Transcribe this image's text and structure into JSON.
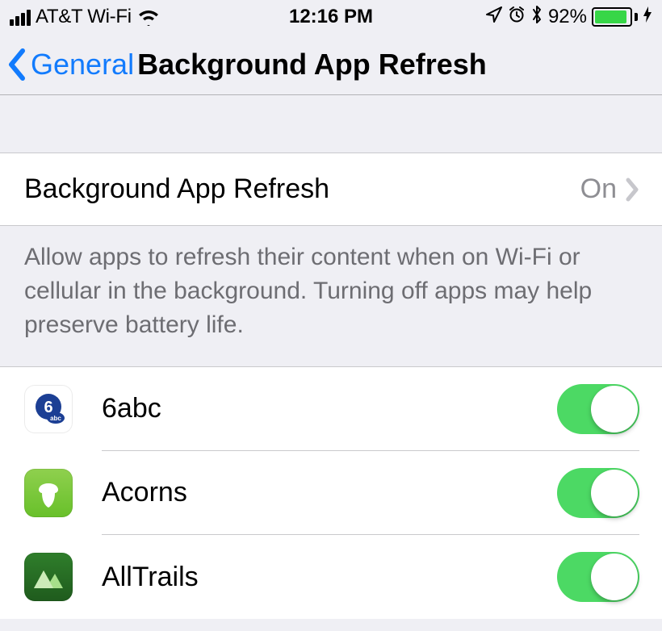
{
  "status": {
    "carrier": "AT&T Wi-Fi",
    "time": "12:16 PM",
    "battery_pct": "92%",
    "battery_fill": "92%"
  },
  "nav": {
    "back_label": "General",
    "title": "Background App Refresh"
  },
  "main": {
    "master_label": "Background App Refresh",
    "master_value": "On",
    "footer": "Allow apps to refresh their content when on Wi-Fi or cellular in the background. Turning off apps may help preserve battery life."
  },
  "apps": [
    {
      "name": "6abc",
      "enabled": true
    },
    {
      "name": "Acorns",
      "enabled": true
    },
    {
      "name": "AllTrails",
      "enabled": true
    }
  ]
}
